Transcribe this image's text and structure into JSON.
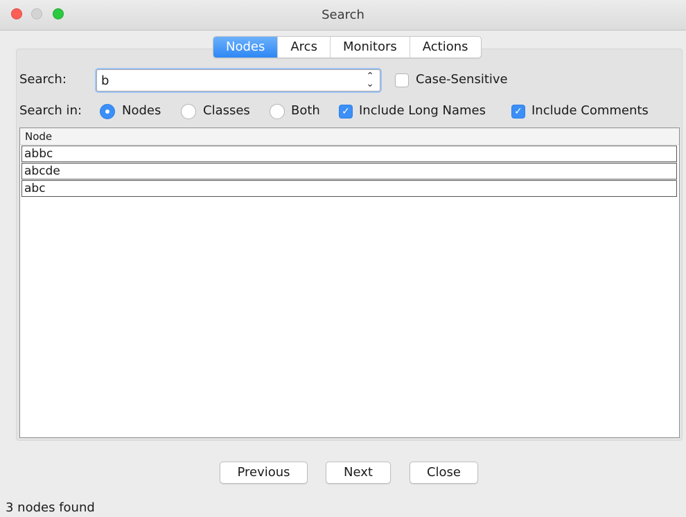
{
  "window": {
    "title": "Search"
  },
  "tabs": [
    "Nodes",
    "Arcs",
    "Monitors",
    "Actions"
  ],
  "search": {
    "label": "Search:",
    "value": "b",
    "case_sensitive_label": "Case-Sensitive",
    "case_sensitive_checked": false
  },
  "search_in": {
    "label": "Search in:",
    "options": [
      "Nodes",
      "Classes",
      "Both"
    ],
    "selected": "Nodes",
    "include_long_names_label": "Include Long Names",
    "include_long_names_checked": true,
    "include_comments_label": "Include Comments",
    "include_comments_checked": true
  },
  "table": {
    "header": "Node",
    "rows": [
      "abbc",
      "abcde",
      "abc"
    ]
  },
  "buttons": {
    "previous": "Previous",
    "next": "Next",
    "close": "Close"
  },
  "status": "3 nodes found",
  "colors": {
    "accent": "#3b8ff7",
    "close_button": "#fd5f57",
    "zoom_button": "#2cc840"
  }
}
